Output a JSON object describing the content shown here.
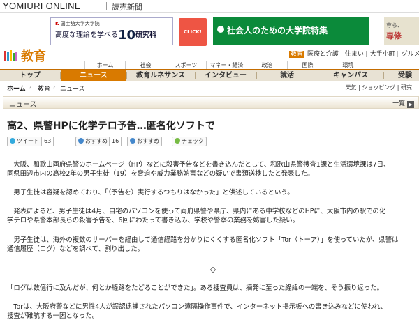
{
  "site": {
    "logo": "YOMIURI ONLINE",
    "paper": "読売新聞"
  },
  "ads": {
    "ad1_org": "国士舘大学大学院",
    "ad1_text": "高度な理論を学べる",
    "ad1_big": "10",
    "ad1_suffix": "研究科",
    "ad1_click": "CLICK!",
    "ad2_text": "社会人のための大学院特集",
    "ad3_line1": "専ら、",
    "ad3_line2": "専修"
  },
  "section": {
    "title": "教育",
    "toplinks": [
      "教育",
      "医療と介護",
      "住まい",
      "大手小町",
      "グルメ"
    ]
  },
  "gnav": [
    "ホーム",
    "社会",
    "スポーツ",
    "マネー・経済",
    "政治",
    "国際",
    "環境"
  ],
  "lnav": [
    "トップ",
    "ニュース",
    "教育ルネサンス",
    "インタビュー",
    "就活",
    "キャンパス",
    "受験"
  ],
  "breadcrumb": {
    "items": [
      "ホーム",
      "教育",
      "ニュース"
    ],
    "right": "天気 | ショッピング | 研究"
  },
  "newsbar": {
    "label": "ニュース",
    "list_link": "一覧"
  },
  "article": {
    "headline": "高2、県警HPに化学テロ予告…匿名化ソフトで",
    "social": {
      "tweet": "ツイート",
      "tweet_count": "63",
      "osusume1": "おすすめ",
      "osusume1_count": "16",
      "osusume2": "おすすめ",
      "check": "チェック"
    },
    "paragraphs": [
      "　大阪、和歌山両府県警のホームページ（HP）などに殺害予告などを書き込んだとして、和歌山県警捜査1課と生活環境課は7日、",
      "同県田辺市内の高校2年の男子生徒（19）を脅迫や威力業務妨害などの疑いで書類送検したと発表した。",
      "　男子生徒は容疑を認めており、「（予告を）実行するつもりはなかった」と供述しているという。",
      "　発表によると、男子生徒は4月、自宅のパソコンを使って両府県警や県庁、県内にある中学校などのHPに、大阪市内の駅での化",
      "学テロや県警本部長らの殺害予告を、6回にわたって書き込み、学校や警察の業務を妨害した疑い。",
      "　男子生徒は、海外の複数のサーバーを経由して通信経路を分かりにくくする匿名化ソフト「Tor（トーア）」を使っていたが、県警は",
      "通信履歴（ログ）などを調べて、割り出した。",
      "◇",
      "「ログは数億行に及んだが、何とか経路をたどることができた」。ある捜査員は、摘発に至った経緯の一端を、そう振り返った。",
      "　Torは、大阪府警などに男性4人が誤認逮捕されたパソコン遠隔操作事件で、インターネット掲示板への書き込みなどに使われ、",
      "捜査が難航する一因となった。"
    ]
  },
  "colors": {
    "accent": "#d97a00",
    "green_ad": "#0b8a3a"
  }
}
